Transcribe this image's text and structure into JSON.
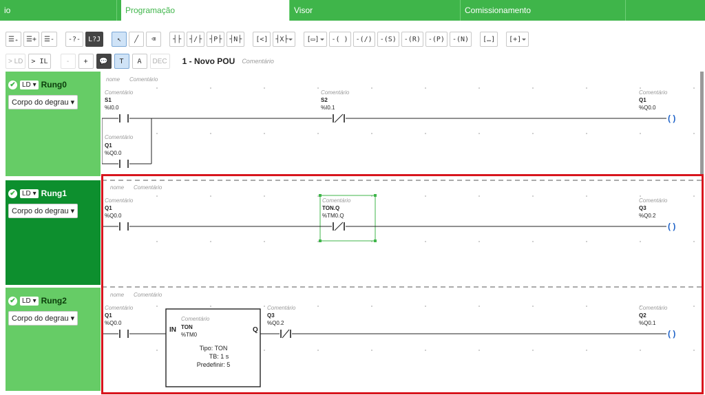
{
  "tabs": [
    {
      "label": "io",
      "active": false
    },
    {
      "label": "Programação",
      "active": true
    },
    {
      "label": "Visor",
      "active": false
    },
    {
      "label": "Comissionamento",
      "active": false
    },
    {
      "label": "",
      "active": false
    }
  ],
  "toolbar": {
    "row1": [
      {
        "name": "insert-rung-below-button",
        "label": "☰₊",
        "style": "normal"
      },
      {
        "name": "insert-rung-after-button",
        "label": "☰+",
        "style": "normal"
      },
      {
        "name": "delete-rung-button",
        "label": "☰-",
        "style": "normal"
      },
      {
        "name": "sep1",
        "label": "",
        "style": "sp"
      },
      {
        "name": "comment-toggle-button",
        "label": "-?-",
        "style": "normal"
      },
      {
        "name": "jump-button",
        "label": "L?J",
        "style": "dark"
      },
      {
        "name": "sep2",
        "label": "",
        "style": "sp"
      },
      {
        "name": "select-pointer-button",
        "label": "↖",
        "style": "sel"
      },
      {
        "name": "draw-wire-button",
        "label": "╱",
        "style": "normal"
      },
      {
        "name": "eraser-button",
        "label": "⌫",
        "style": "normal"
      },
      {
        "name": "sep3",
        "label": "",
        "style": "sp"
      },
      {
        "name": "no-contact-button",
        "label": "┤├",
        "style": "normal"
      },
      {
        "name": "nc-contact-button",
        "label": "┤/├",
        "style": "normal"
      },
      {
        "name": "p-contact-button",
        "label": "┤P├",
        "style": "normal"
      },
      {
        "name": "n-contact-button",
        "label": "┤N├",
        "style": "normal"
      },
      {
        "name": "sep4",
        "label": "",
        "style": "sp"
      },
      {
        "name": "compare-block-button",
        "label": "[<]",
        "style": "normal"
      },
      {
        "name": "contact-dropdown-button",
        "label": "┤X├",
        "style": "dd"
      },
      {
        "name": "sep5",
        "label": "",
        "style": "sp"
      },
      {
        "name": "function-block-dropdown",
        "label": "[▭]",
        "style": "dd"
      },
      {
        "name": "coil-button",
        "label": "-( )",
        "style": "normal"
      },
      {
        "name": "negated-coil-button",
        "label": "-(/)",
        "style": "normal"
      },
      {
        "name": "set-coil-button",
        "label": "-(S)",
        "style": "normal"
      },
      {
        "name": "reset-coil-button",
        "label": "-(R)",
        "style": "normal"
      },
      {
        "name": "p-coil-button",
        "label": "-(P)",
        "style": "normal"
      },
      {
        "name": "n-coil-button",
        "label": "-(N)",
        "style": "normal"
      },
      {
        "name": "sep6",
        "label": "",
        "style": "sp"
      },
      {
        "name": "operate-block-button",
        "label": "[…]",
        "style": "normal"
      },
      {
        "name": "sep7",
        "label": "",
        "style": "sp"
      },
      {
        "name": "expand-dropdown-button",
        "label": "[+]",
        "style": "dd"
      }
    ],
    "row2": [
      {
        "name": "convert-ld-button",
        "label": "> LD",
        "style": "ghost"
      },
      {
        "name": "convert-il-button",
        "label": "> IL",
        "style": "normal"
      },
      {
        "name": "sep8",
        "label": "",
        "style": "sp"
      },
      {
        "name": "zoom-out-button",
        "label": "-",
        "style": "ghost"
      },
      {
        "name": "zoom-in-button",
        "label": "+",
        "style": "normal"
      },
      {
        "name": "comment-view-button",
        "label": "💬",
        "style": "dark"
      },
      {
        "name": "text-view-button",
        "label": "T",
        "style": "sel"
      },
      {
        "name": "font-size-button",
        "label": "A",
        "style": "normal"
      },
      {
        "name": "dec-button",
        "label": "DEC",
        "style": "ghost"
      }
    ]
  },
  "pou": {
    "title": "1 - Novo POU",
    "comment": "Comentário"
  },
  "rungs": [
    {
      "name": "Rung0",
      "lang": "LD",
      "body": "Corpo do degrau"
    },
    {
      "name": "Rung1",
      "lang": "LD",
      "body": "Corpo do degrau"
    },
    {
      "name": "Rung2",
      "lang": "LD",
      "body": "Corpo do degrau"
    }
  ],
  "ladder": {
    "comment": "Comentário",
    "name_label": "nome",
    "rung0": {
      "contact1": {
        "var": "S1",
        "addr": "%I0.0"
      },
      "contact2": {
        "var": "S2",
        "addr": "%I0.1"
      },
      "branch": {
        "var": "Q1",
        "addr": "%Q0.0"
      },
      "coil": {
        "var": "Q1",
        "addr": "%Q0.0"
      }
    },
    "rung1": {
      "contact1": {
        "var": "Q1",
        "addr": "%Q0.0"
      },
      "contact2": {
        "var": "TON.Q",
        "addr": "%TM0.Q"
      },
      "coil": {
        "var": "Q3",
        "addr": "%Q0.2"
      }
    },
    "rung2": {
      "contact1": {
        "var": "Q1",
        "addr": "%Q0.0"
      },
      "block": {
        "in": "IN",
        "out": "Q",
        "name": "TON",
        "addr": "%TM0",
        "tipo": "Tipo: TON",
        "tb": "TB: 1 s",
        "preset": "Predefinir: 5"
      },
      "contact2": {
        "var": "Q3",
        "addr": "%Q0.2"
      },
      "coil": {
        "var": "Q2",
        "addr": "%Q0.1"
      }
    }
  },
  "colors": {
    "green": "#3fb54a",
    "dark_green": "#0d8f2e",
    "light_green": "#66cc66",
    "red": "#d8151d"
  }
}
